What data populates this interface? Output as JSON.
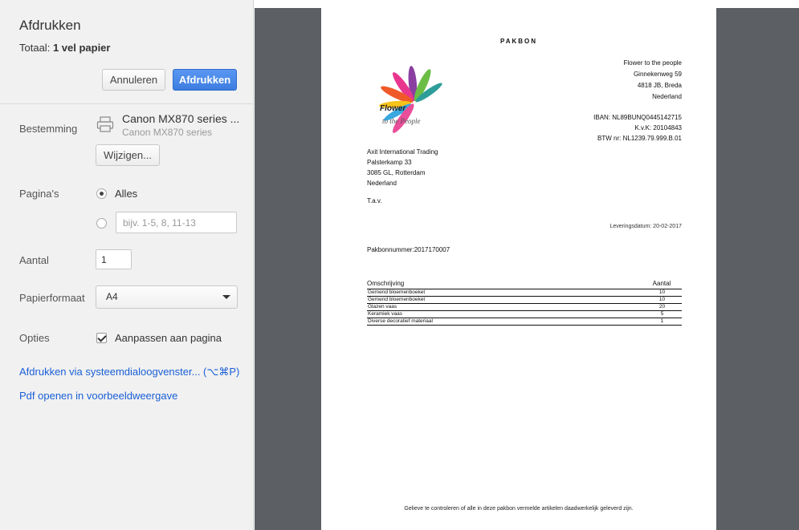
{
  "dialog": {
    "title": "Afdrukken",
    "total_label": "Totaal:",
    "total_value": "1 vel papier",
    "cancel_label": "Annuleren",
    "print_label": "Afdrukken"
  },
  "destination": {
    "label": "Bestemming",
    "printer_name": "Canon MX870 series ...",
    "printer_sub": "Canon MX870 series",
    "change_label": "Wijzigen..."
  },
  "pages": {
    "label": "Pagina's",
    "all_label": "Alles",
    "range_placeholder": "bijv. 1-5, 8, 11-13"
  },
  "copies": {
    "label": "Aantal",
    "value": "1"
  },
  "paper": {
    "label": "Papierformaat",
    "value": "A4"
  },
  "options": {
    "label": "Opties",
    "fit_label": "Aanpassen aan pagina"
  },
  "links": {
    "system_dialog": "Afdrukken via systeemdialoogvenster... (⌥⌘P)",
    "open_pdf": "Pdf openen in voorbeeldweergave"
  },
  "document": {
    "title": "PAKBON",
    "logo_line1": "Flower",
    "logo_line2": "to the People",
    "company": [
      "Flower to the people",
      "Ginnekenweg 59",
      "4818 JB, Breda",
      "Nederland"
    ],
    "bank": [
      "IBAN: NL89BUNQ0445142715",
      "K.v.K: 20104843",
      "BTW nr: NL1239.79.999.B.01"
    ],
    "customer": [
      "Axit International Trading",
      "Palsterkamp 33",
      "3085 GL, Rotterdam",
      "Nederland"
    ],
    "attn": "T.a.v.",
    "delivery_date": "Leveringsdatum: 20-02-2017",
    "packing_number": "Pakbonnummer:2017170007",
    "table": {
      "headers": [
        "Omschrijving",
        "Aantal"
      ],
      "rows": [
        [
          "Gemend bloemenboeket",
          "10"
        ],
        [
          "Gemend bloemenboeket",
          "10"
        ],
        [
          "Glazen vaas",
          "20"
        ],
        [
          "Keramiek vaas",
          "5"
        ],
        [
          "Diverse decoratief materiaal",
          "1"
        ]
      ]
    },
    "footer": "Gelieve te controleren of alle in deze pakbon vermelde artikelen daadwerkelijk geleverd zijn."
  }
}
